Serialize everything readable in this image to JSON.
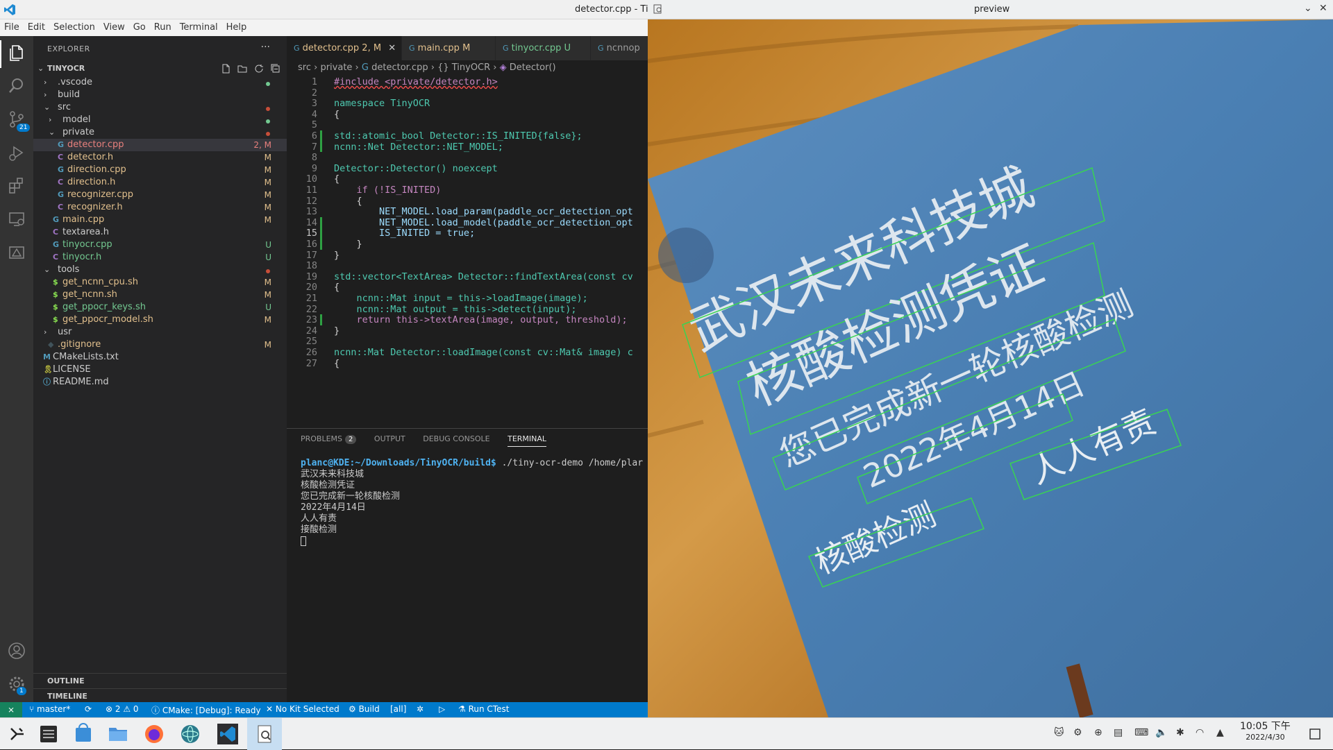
{
  "window_title": "detector.cpp - Tin",
  "menu": [
    "File",
    "Edit",
    "Selection",
    "View",
    "Go",
    "Run",
    "Terminal",
    "Help"
  ],
  "activity_badges": {
    "scm": "21",
    "settings": "1"
  },
  "explorer": {
    "header": "EXPLORER",
    "more": "···",
    "root": "TINYOCR",
    "items": [
      {
        "label": ".vscode",
        "status": "",
        "kind": "folder"
      },
      {
        "label": "build",
        "status": "",
        "kind": "folder"
      },
      {
        "label": "src",
        "status": "",
        "kind": "folder-open"
      },
      {
        "label": "model",
        "status": "",
        "kind": "folder"
      },
      {
        "label": "private",
        "status": "",
        "kind": "folder-open"
      },
      {
        "label": "detector.cpp",
        "status": "2, M",
        "kind": "cpp"
      },
      {
        "label": "detector.h",
        "status": "M",
        "kind": "h"
      },
      {
        "label": "direction.cpp",
        "status": "M",
        "kind": "cpp"
      },
      {
        "label": "direction.h",
        "status": "M",
        "kind": "h"
      },
      {
        "label": "recognizer.cpp",
        "status": "M",
        "kind": "cpp"
      },
      {
        "label": "recognizer.h",
        "status": "M",
        "kind": "h"
      },
      {
        "label": "main.cpp",
        "status": "M",
        "kind": "cpp"
      },
      {
        "label": "textarea.h",
        "status": "",
        "kind": "h"
      },
      {
        "label": "tinyocr.cpp",
        "status": "U",
        "kind": "cpp"
      },
      {
        "label": "tinyocr.h",
        "status": "U",
        "kind": "h"
      },
      {
        "label": "tools",
        "status": "",
        "kind": "folder-open"
      },
      {
        "label": "get_ncnn_cpu.sh",
        "status": "M",
        "kind": "sh"
      },
      {
        "label": "get_ncnn.sh",
        "status": "M",
        "kind": "sh"
      },
      {
        "label": "get_ppocr_keys.sh",
        "status": "U",
        "kind": "sh"
      },
      {
        "label": "get_ppocr_model.sh",
        "status": "M",
        "kind": "sh"
      },
      {
        "label": "usr",
        "status": "",
        "kind": "folder"
      },
      {
        "label": ".gitignore",
        "status": "M",
        "kind": "git"
      },
      {
        "label": "CMakeLists.txt",
        "status": "",
        "kind": "cmake"
      },
      {
        "label": "LICENSE",
        "status": "",
        "kind": "license"
      },
      {
        "label": "README.md",
        "status": "",
        "kind": "info"
      }
    ],
    "outline": "OUTLINE",
    "timeline": "TIMELINE"
  },
  "tabs": [
    {
      "label": "detector.cpp",
      "suffix": "2, M",
      "active": true
    },
    {
      "label": "main.cpp",
      "suffix": "M",
      "active": false
    },
    {
      "label": "tinyocr.cpp",
      "suffix": "U",
      "active": false
    },
    {
      "label": "ncnnop",
      "suffix": "",
      "active": false
    }
  ],
  "breadcrumb": [
    "src",
    "private",
    "detector.cpp",
    "{} TinyOCR",
    "Detector()"
  ],
  "code_lines": [
    "#include <private/detector.h>",
    "",
    "namespace TinyOCR",
    "{",
    "",
    "std::atomic_bool Detector::IS_INITED{false};",
    "ncnn::Net Detector::NET_MODEL;",
    "",
    "Detector::Detector() noexcept",
    "{",
    "    if (!IS_INITED)",
    "    {",
    "        NET_MODEL.load_param(paddle_ocr_detection_opt",
    "        NET_MODEL.load_model(paddle_ocr_detection_opt",
    "        IS_INITED = true;",
    "    }",
    "}",
    "",
    "std::vector<TextArea> Detector::findTextArea(const cv",
    "{",
    "    ncnn::Mat input = this->loadImage(image);",
    "    ncnn::Mat output = this->detect(input);",
    "    return this->textArea(image, output, threshold);",
    "}",
    "",
    "ncnn::Mat Detector::loadImage(const cv::Mat& image) c",
    "{"
  ],
  "current_line": 15,
  "panel": {
    "tabs": [
      "PROBLEMS",
      "OUTPUT",
      "DEBUG CONSOLE",
      "TERMINAL"
    ],
    "problems_count": "2",
    "active": "TERMINAL",
    "prompt": "planc@KDE:~/Downloads/TinyOCR/build$",
    "command": " ./tiny-ocr-demo /home/plar",
    "output": [
      "武汉未来科技城",
      "核酸检测凭证",
      "您已完成新一轮核酸检测",
      "2022年4月14日",
      "人人有责",
      "接酸检测"
    ]
  },
  "status": {
    "branch": "master*",
    "errors": "⊗ 2 ⚠ 0",
    "cmake": "CMake: [Debug]: Ready",
    "kit": "No Kit Selected",
    "build": "Build",
    "target": "[all]",
    "ctest": "Run CTest"
  },
  "preview": {
    "title": "preview",
    "texts": [
      "武汉未来科技城",
      "核酸检测凭证",
      "您已完成新一轮核酸检测",
      "2022年4月14日",
      "人人有责",
      "核酸检测"
    ]
  },
  "clock": {
    "time": "10:05 下午",
    "date": "2022/4/30"
  },
  "colors": {
    "accent": "#007acc",
    "modified": "#e2c08d",
    "untracked": "#73c991",
    "folder_dot": "#c74e39",
    "prompt": "#4fb3f2"
  }
}
